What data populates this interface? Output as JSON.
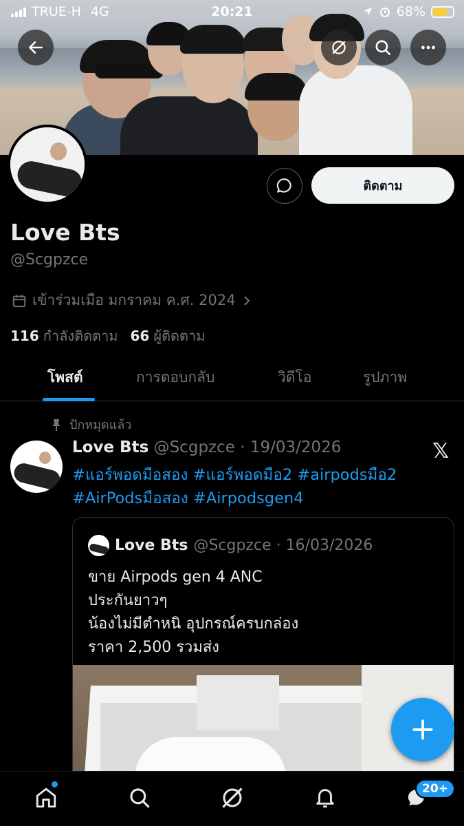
{
  "status_bar": {
    "carrier": "TRUE-H",
    "network": "4G",
    "time": "20:21",
    "battery": "68%",
    "battery_level": 0.68
  },
  "profile": {
    "name": "Love Bts",
    "handle": "@Scgpzce",
    "joined": "เข้าร่วมเมือ มกราคม ค.ศ. 2024",
    "following_count": "116",
    "following_label": "กำลังติดตาม",
    "followers_count": "66",
    "followers_label": "ผู้ติดตาม",
    "follow_button": "ติดตาม"
  },
  "tabs": [
    {
      "label": "โพสต์",
      "active": true
    },
    {
      "label": "การตอบกลับ",
      "active": false
    },
    {
      "label": "วิดีโอ",
      "active": false
    },
    {
      "label": "รูปภาพ",
      "active": false
    }
  ],
  "pinned_post": {
    "pinned_label": "ปักหมุดแล้ว",
    "author": "Love Bts",
    "handle_date": "@Scgpzce · 19/03/2026",
    "hashtags_line1": "#แอร์พอดมือสอง #แอร์พอดมือ2 #airpodsมือ2",
    "hashtags_line2": "#AirPodsมือสอง #Airpodsgen4",
    "quote": {
      "author": "Love Bts",
      "handle_date": "@Scgpzce · 16/03/2026",
      "lines": [
        "ขาย Airpods gen 4 ANC",
        "ประกันยาวๆ",
        "น้องไม่มีตำหนิ  อุปกรณ์ครบกล่อง",
        "ราคา  2,500  รวมส่ง"
      ]
    }
  },
  "bottom_nav": {
    "badge": "20+"
  },
  "colors": {
    "accent": "#1d9bf0",
    "background": "#000000",
    "secondary_text": "#71767b"
  }
}
